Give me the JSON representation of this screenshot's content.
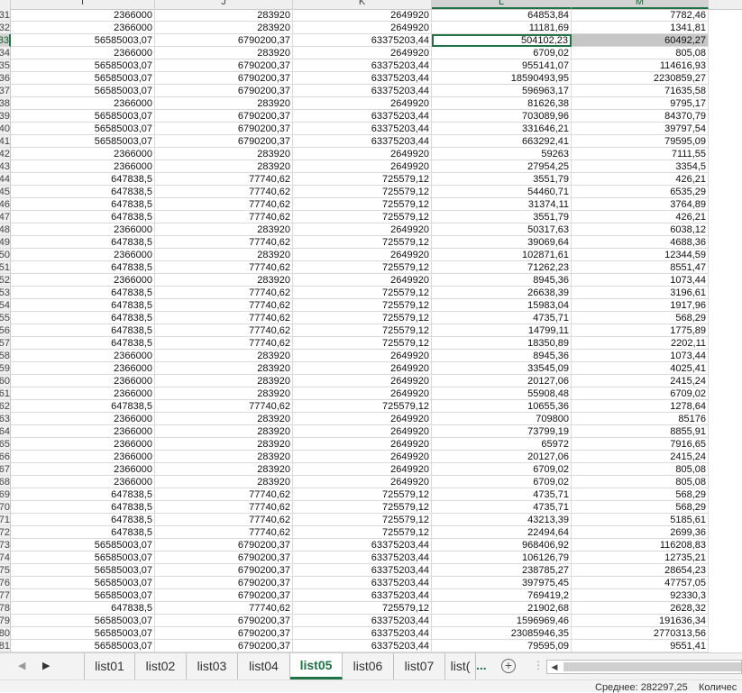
{
  "columns": [
    {
      "label": "I"
    },
    {
      "label": "J"
    },
    {
      "label": "K"
    },
    {
      "label": "L"
    },
    {
      "label": "M"
    }
  ],
  "rows": [
    {
      "n": "31",
      "I": "2366000",
      "J": "283920",
      "K": "2649920",
      "L": "64853,84",
      "M": "7782,46"
    },
    {
      "n": "32",
      "I": "2366000",
      "J": "283920",
      "K": "2649920",
      "L": "11181,69",
      "M": "1341,81"
    },
    {
      "n": "33",
      "I": "56585003,07",
      "J": "6790200,37",
      "K": "63375203,44",
      "L": "504102,23",
      "M": "60492,27"
    },
    {
      "n": "34",
      "I": "2366000",
      "J": "283920",
      "K": "2649920",
      "L": "6709,02",
      "M": "805,08"
    },
    {
      "n": "35",
      "I": "56585003,07",
      "J": "6790200,37",
      "K": "63375203,44",
      "L": "955141,07",
      "M": "114616,93"
    },
    {
      "n": "36",
      "I": "56585003,07",
      "J": "6790200,37",
      "K": "63375203,44",
      "L": "18590493,95",
      "M": "2230859,27"
    },
    {
      "n": "37",
      "I": "56585003,07",
      "J": "6790200,37",
      "K": "63375203,44",
      "L": "596963,17",
      "M": "71635,58"
    },
    {
      "n": "38",
      "I": "2366000",
      "J": "283920",
      "K": "2649920",
      "L": "81626,38",
      "M": "9795,17"
    },
    {
      "n": "39",
      "I": "56585003,07",
      "J": "6790200,37",
      "K": "63375203,44",
      "L": "703089,96",
      "M": "84370,79"
    },
    {
      "n": "40",
      "I": "56585003,07",
      "J": "6790200,37",
      "K": "63375203,44",
      "L": "331646,21",
      "M": "39797,54"
    },
    {
      "n": "41",
      "I": "56585003,07",
      "J": "6790200,37",
      "K": "63375203,44",
      "L": "663292,41",
      "M": "79595,09"
    },
    {
      "n": "42",
      "I": "2366000",
      "J": "283920",
      "K": "2649920",
      "L": "59263",
      "M": "7111,55"
    },
    {
      "n": "43",
      "I": "2366000",
      "J": "283920",
      "K": "2649920",
      "L": "27954,25",
      "M": "3354,5"
    },
    {
      "n": "44",
      "I": "647838,5",
      "J": "77740,62",
      "K": "725579,12",
      "L": "3551,79",
      "M": "426,21"
    },
    {
      "n": "45",
      "I": "647838,5",
      "J": "77740,62",
      "K": "725579,12",
      "L": "54460,71",
      "M": "6535,29"
    },
    {
      "n": "46",
      "I": "647838,5",
      "J": "77740,62",
      "K": "725579,12",
      "L": "31374,11",
      "M": "3764,89"
    },
    {
      "n": "47",
      "I": "647838,5",
      "J": "77740,62",
      "K": "725579,12",
      "L": "3551,79",
      "M": "426,21"
    },
    {
      "n": "48",
      "I": "2366000",
      "J": "283920",
      "K": "2649920",
      "L": "50317,63",
      "M": "6038,12"
    },
    {
      "n": "49",
      "I": "647838,5",
      "J": "77740,62",
      "K": "725579,12",
      "L": "39069,64",
      "M": "4688,36"
    },
    {
      "n": "50",
      "I": "2366000",
      "J": "283920",
      "K": "2649920",
      "L": "102871,61",
      "M": "12344,59"
    },
    {
      "n": "51",
      "I": "647838,5",
      "J": "77740,62",
      "K": "725579,12",
      "L": "71262,23",
      "M": "8551,47"
    },
    {
      "n": "52",
      "I": "2366000",
      "J": "283920",
      "K": "2649920",
      "L": "8945,36",
      "M": "1073,44"
    },
    {
      "n": "53",
      "I": "647838,5",
      "J": "77740,62",
      "K": "725579,12",
      "L": "26638,39",
      "M": "3196,61"
    },
    {
      "n": "54",
      "I": "647838,5",
      "J": "77740,62",
      "K": "725579,12",
      "L": "15983,04",
      "M": "1917,96"
    },
    {
      "n": "55",
      "I": "647838,5",
      "J": "77740,62",
      "K": "725579,12",
      "L": "4735,71",
      "M": "568,29"
    },
    {
      "n": "56",
      "I": "647838,5",
      "J": "77740,62",
      "K": "725579,12",
      "L": "14799,11",
      "M": "1775,89"
    },
    {
      "n": "57",
      "I": "647838,5",
      "J": "77740,62",
      "K": "725579,12",
      "L": "18350,89",
      "M": "2202,11"
    },
    {
      "n": "58",
      "I": "2366000",
      "J": "283920",
      "K": "2649920",
      "L": "8945,36",
      "M": "1073,44"
    },
    {
      "n": "59",
      "I": "2366000",
      "J": "283920",
      "K": "2649920",
      "L": "33545,09",
      "M": "4025,41"
    },
    {
      "n": "60",
      "I": "2366000",
      "J": "283920",
      "K": "2649920",
      "L": "20127,06",
      "M": "2415,24"
    },
    {
      "n": "61",
      "I": "2366000",
      "J": "283920",
      "K": "2649920",
      "L": "55908,48",
      "M": "6709,02"
    },
    {
      "n": "62",
      "I": "647838,5",
      "J": "77740,62",
      "K": "725579,12",
      "L": "10655,36",
      "M": "1278,64"
    },
    {
      "n": "63",
      "I": "2366000",
      "J": "283920",
      "K": "2649920",
      "L": "709800",
      "M": "85176"
    },
    {
      "n": "64",
      "I": "2366000",
      "J": "283920",
      "K": "2649920",
      "L": "73799,19",
      "M": "8855,91"
    },
    {
      "n": "65",
      "I": "2366000",
      "J": "283920",
      "K": "2649920",
      "L": "65972",
      "M": "7916,65"
    },
    {
      "n": "66",
      "I": "2366000",
      "J": "283920",
      "K": "2649920",
      "L": "20127,06",
      "M": "2415,24"
    },
    {
      "n": "67",
      "I": "2366000",
      "J": "283920",
      "K": "2649920",
      "L": "6709,02",
      "M": "805,08"
    },
    {
      "n": "68",
      "I": "2366000",
      "J": "283920",
      "K": "2649920",
      "L": "6709,02",
      "M": "805,08"
    },
    {
      "n": "69",
      "I": "647838,5",
      "J": "77740,62",
      "K": "725579,12",
      "L": "4735,71",
      "M": "568,29"
    },
    {
      "n": "70",
      "I": "647838,5",
      "J": "77740,62",
      "K": "725579,12",
      "L": "4735,71",
      "M": "568,29"
    },
    {
      "n": "71",
      "I": "647838,5",
      "J": "77740,62",
      "K": "725579,12",
      "L": "43213,39",
      "M": "5185,61"
    },
    {
      "n": "72",
      "I": "647838,5",
      "J": "77740,62",
      "K": "725579,12",
      "L": "22494,64",
      "M": "2699,36"
    },
    {
      "n": "73",
      "I": "56585003,07",
      "J": "6790200,37",
      "K": "63375203,44",
      "L": "968406,92",
      "M": "116208,83"
    },
    {
      "n": "74",
      "I": "56585003,07",
      "J": "6790200,37",
      "K": "63375203,44",
      "L": "106126,79",
      "M": "12735,21"
    },
    {
      "n": "75",
      "I": "56585003,07",
      "J": "6790200,37",
      "K": "63375203,44",
      "L": "238785,27",
      "M": "28654,23"
    },
    {
      "n": "76",
      "I": "56585003,07",
      "J": "6790200,37",
      "K": "63375203,44",
      "L": "397975,45",
      "M": "47757,05"
    },
    {
      "n": "77",
      "I": "56585003,07",
      "J": "6790200,37",
      "K": "63375203,44",
      "L": "769419,2",
      "M": "92330,3"
    },
    {
      "n": "78",
      "I": "647838,5",
      "J": "77740,62",
      "K": "725579,12",
      "L": "21902,68",
      "M": "2628,32"
    },
    {
      "n": "79",
      "I": "56585003,07",
      "J": "6790200,37",
      "K": "63375203,44",
      "L": "1596969,46",
      "M": "191636,34"
    },
    {
      "n": "80",
      "I": "56585003,07",
      "J": "6790200,37",
      "K": "63375203,44",
      "L": "23085946,35",
      "M": "2770313,56"
    },
    {
      "n": "81",
      "I": "56585003,07",
      "J": "6790200,37",
      "K": "63375203,44",
      "L": "79595,09",
      "M": "9551,41"
    }
  ],
  "selection": {
    "active_row": "33",
    "active_col": "L",
    "range_col": "M"
  },
  "sheet_tabs": [
    {
      "label": "list01"
    },
    {
      "label": "list02"
    },
    {
      "label": "list03"
    },
    {
      "label": "list04"
    },
    {
      "label": "list05",
      "active": true
    },
    {
      "label": "list06"
    },
    {
      "label": "list07"
    },
    {
      "label": "list("
    }
  ],
  "tab_overflow": "...",
  "add_sheet_symbol": "+",
  "split_symbol": "⋮",
  "scroll_left_symbol": "◀",
  "nav_prev_symbol": "◀",
  "nav_next_symbol": "▶",
  "status": {
    "average": "Среднее: 282297,25",
    "count": "Количес"
  },
  "colors": {
    "accent": "#217346",
    "selection_fill": "#c6c6c6",
    "header_bg": "#efefef"
  },
  "icons": [
    "sheet-nav-prev-icon",
    "sheet-nav-next-icon",
    "add-sheet-icon",
    "scroll-left-icon"
  ]
}
